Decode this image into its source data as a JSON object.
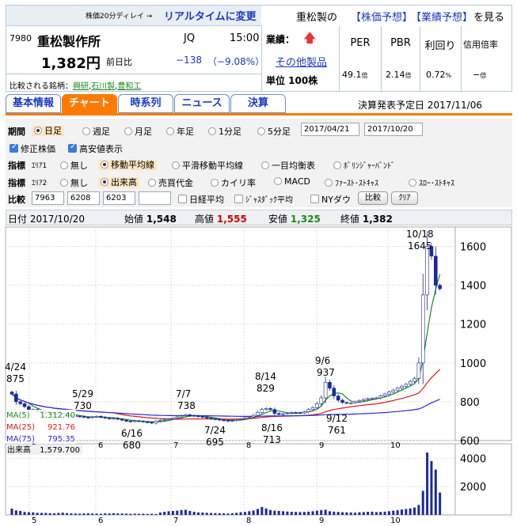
{
  "header": {
    "delay_notice": "株価20分ディレイ →",
    "realtime_link": "リアルタイムに変更",
    "company_prefix": "重松製の",
    "forecast_link": "【株価予想】",
    "earnings_link": "【業績予想】",
    "view_suffix": "を見る"
  },
  "stock": {
    "code": "7980",
    "name": "重松製作所",
    "market": "JQ",
    "time": "15:00",
    "price": "1,382円",
    "change_label": "前日比",
    "change": "−138",
    "change_pct": "（−9.08%）",
    "compare_label": "比較される銘柄：",
    "peers": [
      "興研",
      "石川製",
      "豊和工"
    ],
    "sector_label": "業績：",
    "other_products": "その他製品",
    "unit": "単位 100株",
    "per_label": "PER",
    "per": "49.1",
    "per_unit": "倍",
    "pbr_label": "PBR",
    "pbr": "2.14",
    "pbr_unit": "倍",
    "yield_label": "利回り",
    "yield": "0.72",
    "yield_unit": "%",
    "margin_label": "信用倍率",
    "margin": "−",
    "margin_unit": "倍"
  },
  "tabs": [
    "基本情報",
    "チャート",
    "時系列",
    "ニュース",
    "決算"
  ],
  "earnings_date": "決算発表予定日  2017/11/06",
  "controls": {
    "period_label": "期間",
    "periods": [
      "日足",
      "週足",
      "月足",
      "年足",
      "1分足",
      "5分足"
    ],
    "date_from": "2017/04/21",
    "date_to": "2017/10/20",
    "adjusted": "修正株価",
    "hl_display": "高安値表示",
    "indicator_label": "指標",
    "area1": "ｴﾘｱ1",
    "area1_opts": [
      "無し",
      "移動平均線",
      "平滑移動平均線",
      "一目均衡表",
      "ﾎﾞﾘﾝｼﾞｬｰﾊﾞﾝﾄﾞ"
    ],
    "area2": "ｴﾘｱ2",
    "area2_opts": [
      "無し",
      "出来高",
      "売買代金",
      "カイリ率",
      "MACD",
      "ﾌｧｰｽﾄ･ｽﾄｷｬｽ",
      "ｽﾛｰ･ｽﾄｷｬｽ"
    ],
    "compare_label": "比較",
    "compare_codes": [
      "7963",
      "6208",
      "6203",
      ""
    ],
    "nikkei": "日経平均",
    "jasdaq": "ｼﾞｬｽﾀﾞｯｸ平均",
    "nydow": "NYダウ",
    "compare_btn": "比較",
    "clear_btn": "ｸﾘｱ"
  },
  "chart_info": {
    "date_label": "日付",
    "date": "2017/10/20",
    "open_label": "始値",
    "open": "1,548",
    "high_label": "高値",
    "high": "1,555",
    "low_label": "安値",
    "low": "1,325",
    "close_label": "終値",
    "close": "1,382"
  },
  "colors": {
    "up": "#ffffff",
    "down": "#1a2a9a",
    "ma5": "#1a8a1a",
    "ma25": "#d81a1a",
    "ma75": "#2a2ad8",
    "accent": "#ff7a00"
  },
  "chart_data": {
    "type": "candlestick",
    "ylim": [
      600,
      1700
    ],
    "y_ticks": [
      "1600",
      "1400",
      "1200",
      "1000",
      "800",
      "600"
    ],
    "x_ticks": [
      "5",
      "6",
      "7",
      "8",
      "9",
      "10"
    ],
    "annotations": [
      {
        "date": "4/24",
        "value": "875"
      },
      {
        "date": "5/29",
        "value": "730"
      },
      {
        "date": "6/16",
        "value": "680"
      },
      {
        "date": "7/7",
        "value": "738"
      },
      {
        "date": "7/24",
        "value": "695"
      },
      {
        "date": "8/14",
        "value": "829"
      },
      {
        "date": "8/16",
        "value": "713"
      },
      {
        "date": "9/6",
        "value": "937"
      },
      {
        "date": "9/12",
        "value": "761"
      },
      {
        "date": "10/18",
        "value": "1645"
      }
    ],
    "ma": [
      {
        "name": "MA(5)",
        "value": "1,312.40"
      },
      {
        "name": "MA(25)",
        "value": "921.76"
      },
      {
        "name": "MA(75)",
        "value": "795.35"
      }
    ],
    "volume_label": "出来高",
    "volume": "1,579.700",
    "vol_ticks": [
      "4000",
      "2000"
    ],
    "vol_ylim": [
      0,
      4800
    ],
    "closes": [
      840,
      800,
      790,
      775,
      760,
      760,
      750,
      745,
      740,
      742,
      735,
      738,
      740,
      730,
      728,
      726,
      724,
      720,
      718,
      722,
      725,
      720,
      716,
      712,
      715,
      710,
      705,
      700,
      698,
      702,
      700,
      696,
      694,
      690,
      700,
      705,
      710,
      712,
      715,
      722,
      728,
      733,
      730,
      727,
      724,
      720,
      716,
      712,
      710,
      706,
      704,
      700,
      703,
      708,
      712,
      718,
      722,
      730,
      745,
      760,
      765,
      760,
      740,
      735,
      738,
      742,
      745,
      744,
      742,
      748,
      760,
      770,
      790,
      820,
      900,
      870,
      830,
      808,
      796,
      792,
      794,
      800,
      806,
      812,
      816,
      818,
      820,
      830,
      840,
      850,
      860,
      870,
      880,
      890,
      905,
      920,
      1000,
      1350,
      1600,
      1550,
      1400,
      1382
    ],
    "volumes": [
      450,
      320,
      280,
      210,
      190,
      180,
      150,
      140,
      140,
      120,
      110,
      140,
      160,
      130,
      110,
      100,
      90,
      110,
      120,
      100,
      90,
      80,
      110,
      100,
      120,
      110,
      100,
      90,
      80,
      90,
      80,
      90,
      70,
      80,
      60,
      170,
      220,
      260,
      280,
      300,
      340,
      360,
      280,
      220,
      180,
      170,
      150,
      140,
      130,
      120,
      110,
      100,
      120,
      150,
      190,
      210,
      260,
      310,
      420,
      560,
      460,
      350,
      300,
      280,
      260,
      240,
      220,
      210,
      200,
      210,
      230,
      260,
      300,
      340,
      370,
      260,
      230,
      210,
      190,
      180,
      170,
      160,
      190,
      200,
      220,
      230,
      200,
      210,
      230,
      260,
      300,
      330,
      380,
      420,
      460,
      520,
      700,
      1700,
      4400,
      3800,
      3200,
      1580
    ]
  }
}
